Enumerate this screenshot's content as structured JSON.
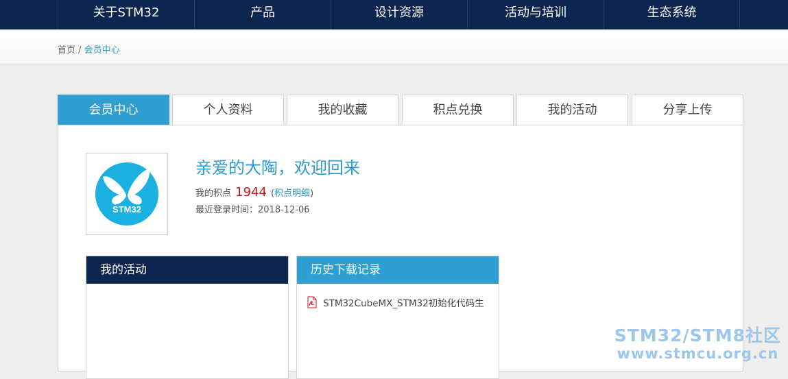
{
  "nav": {
    "items": [
      {
        "label": "关于STM32"
      },
      {
        "label": "产品"
      },
      {
        "label": "设计资源"
      },
      {
        "label": "活动与培训"
      },
      {
        "label": "生态系统"
      }
    ]
  },
  "breadcrumb": {
    "home": "首页",
    "separator": " / ",
    "current": "会员中心"
  },
  "tabs": [
    {
      "label": "会员中心",
      "active": true
    },
    {
      "label": "个人资料"
    },
    {
      "label": "我的收藏"
    },
    {
      "label": "积点兑换"
    },
    {
      "label": "我的活动"
    },
    {
      "label": "分享上传"
    }
  ],
  "profile": {
    "avatar_text": "STM32",
    "welcome": "亲爱的大陶，欢迎回来",
    "points_label": "我的积点",
    "points_value": "1944",
    "points_link_open": "(",
    "points_link": "积点明细",
    "points_link_close": ")",
    "last_login_label": "最近登录时间：",
    "last_login": "2018-12-06"
  },
  "activity_box": {
    "title": "我的活动"
  },
  "history_box": {
    "title": "历史下载记录",
    "items": [
      {
        "label": "STM32CubeMX_STM32初始化代码生",
        "icon": "pdf-icon"
      }
    ]
  },
  "watermark": {
    "line1": "STM32/STM8社区",
    "line2": "www.stmcu.org.cn"
  },
  "colors": {
    "nav_bg": "#0c2650",
    "accent": "#2e9fd0",
    "points": "#c8161d"
  }
}
